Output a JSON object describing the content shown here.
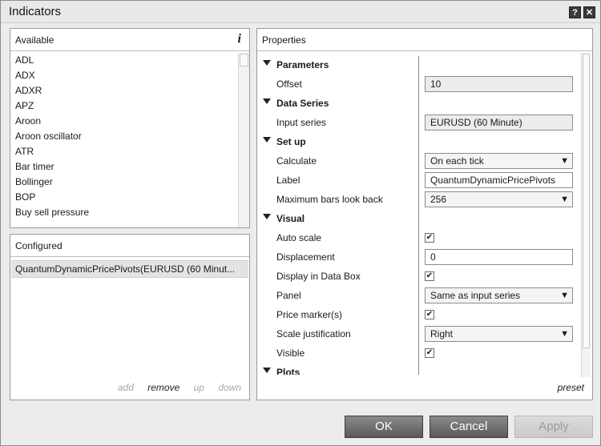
{
  "window": {
    "title": "Indicators",
    "help_glyph": "?",
    "close_glyph": "✕"
  },
  "available": {
    "header": "Available",
    "info_glyph": "i",
    "items": [
      "ADL",
      "ADX",
      "ADXR",
      "APZ",
      "Aroon",
      "Aroon oscillator",
      "ATR",
      "Bar timer",
      "Bollinger",
      "BOP",
      "Buy sell pressure"
    ]
  },
  "configured": {
    "header": "Configured",
    "items": [
      "QuantumDynamicPricePivots(EURUSD (60 Minut..."
    ],
    "actions": {
      "add": "add",
      "remove": "remove",
      "up": "up",
      "down": "down"
    }
  },
  "properties": {
    "header": "Properties",
    "categories": {
      "parameters": "Parameters",
      "data_series": "Data Series",
      "set_up": "Set up",
      "visual": "Visual",
      "plots": "Plots"
    },
    "offset": {
      "label": "Offset",
      "value": "10"
    },
    "input_series": {
      "label": "Input series",
      "value": "EURUSD (60 Minute)"
    },
    "calculate": {
      "label": "Calculate",
      "value": "On each tick"
    },
    "label": {
      "label": "Label",
      "value": "QuantumDynamicPricePivots"
    },
    "max_bars": {
      "label": "Maximum bars look back",
      "value": "256"
    },
    "auto_scale": {
      "label": "Auto scale",
      "checked": true
    },
    "displacement": {
      "label": "Displacement",
      "value": "0"
    },
    "display_in_data_box": {
      "label": "Display in Data Box",
      "checked": true
    },
    "panel": {
      "label": "Panel",
      "value": "Same as input series"
    },
    "price_markers": {
      "label": "Price marker(s)",
      "checked": true
    },
    "scale_justification": {
      "label": "Scale justification",
      "value": "Right"
    },
    "visible": {
      "label": "Visible",
      "checked": true
    },
    "preset": "preset"
  },
  "buttons": {
    "ok": "OK",
    "cancel": "Cancel",
    "apply": "Apply"
  },
  "check_glyph": "✔",
  "chevron_glyph": "▼"
}
